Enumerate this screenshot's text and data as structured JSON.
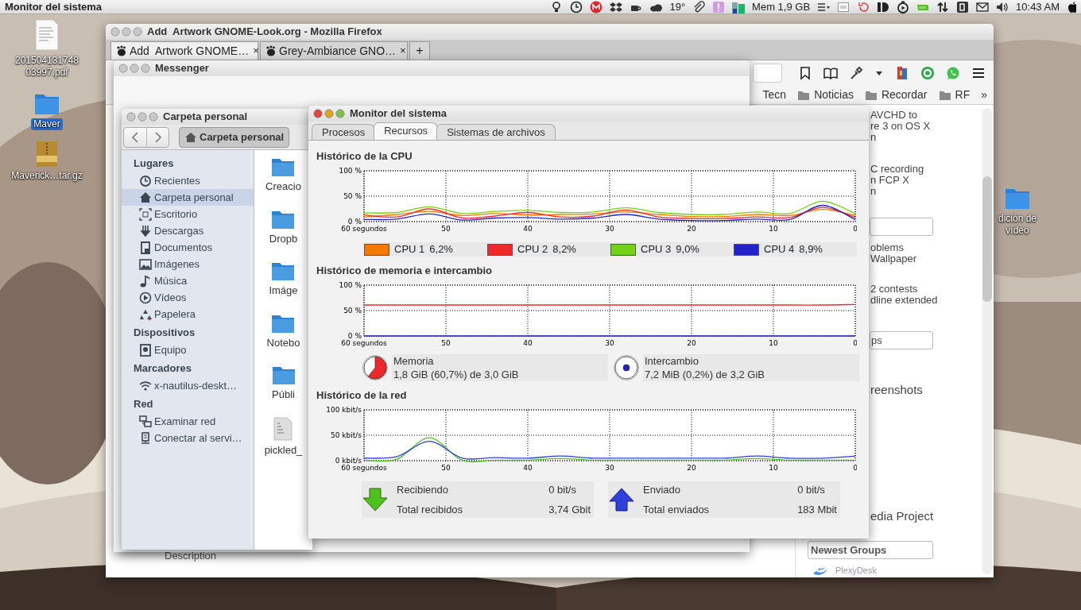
{
  "top_panel": {
    "app_name": "Monitor del sistema",
    "weather": "19°",
    "memory": "Mem 1,9 GB",
    "clock": "10:43 AM"
  },
  "desktop_icons": [
    {
      "label": "201504131748 03997.pdf",
      "kind": "pdf",
      "selected": false
    },
    {
      "label": "Maver",
      "kind": "folder",
      "selected": true
    },
    {
      "label": "Maverick…tar.gz",
      "kind": "archive",
      "selected": false
    },
    {
      "label": "dición de vídeo",
      "kind": "folder",
      "selected": false
    }
  ],
  "firefox": {
    "title": "Add  Artwork GNOME-Look.org - Mozilla Firefox",
    "focused": false,
    "tabs": [
      {
        "label": "Add  Artwork GNOME…",
        "close": "×",
        "selected": true
      },
      {
        "label": "Grey-Ambiance GNO…",
        "close": "×",
        "selected": false
      }
    ],
    "new_tab": "+",
    "bookmarks": [
      "Tecn",
      "Noticias",
      "Recordar",
      "RF"
    ],
    "bookmarks_more": "»",
    "page": {
      "column": [
        {
          "kind": "text",
          "lines": [
            "AVCHD to",
            "re 3 on OS X",
            "n"
          ]
        },
        {
          "kind": "text",
          "lines": [
            "C recording",
            "n FCP X",
            "n"
          ]
        },
        {
          "kind": "field"
        },
        {
          "kind": "text",
          "lines": [
            "oblems",
            "Wallpaper"
          ]
        },
        {
          "kind": "text",
          "lines": [
            "2 contests",
            "dline extended"
          ]
        },
        {
          "kind": "field",
          "value": "ps"
        },
        {
          "kind": "heading",
          "text": "reenshots"
        },
        {
          "kind": "heading",
          "text": "edia Project"
        },
        {
          "kind": "field",
          "value": "Newest Groups"
        },
        {
          "kind": "logo",
          "text": "PlexyDesk"
        }
      ],
      "footer": "Description"
    }
  },
  "messenger": {
    "title": "Messenger",
    "focused": false
  },
  "files": {
    "title": "Carpeta personal",
    "focused": false,
    "path_button": "Carpeta personal",
    "sidebar": [
      {
        "title": "Lugares",
        "items": [
          {
            "label": "Recientes",
            "selected": false
          },
          {
            "label": "Carpeta personal",
            "selected": true
          },
          {
            "label": "Escritorio",
            "selected": false
          },
          {
            "label": "Descargas",
            "selected": false
          },
          {
            "label": "Documentos",
            "selected": false
          },
          {
            "label": "Imágenes",
            "selected": false
          },
          {
            "label": "Música",
            "selected": false
          },
          {
            "label": "Vídeos",
            "selected": false
          },
          {
            "label": "Papelera",
            "selected": false
          }
        ]
      },
      {
        "title": "Dispositivos",
        "items": [
          {
            "label": "Equipo",
            "selected": false
          }
        ]
      },
      {
        "title": "Marcadores",
        "items": [
          {
            "label": "x-nautilus-deskt…",
            "selected": false
          }
        ]
      },
      {
        "title": "Red",
        "items": [
          {
            "label": "Examinar red",
            "selected": false
          },
          {
            "label": "Conectar al servi…",
            "selected": false
          }
        ]
      }
    ],
    "items": [
      {
        "label": "Creacio",
        "kind": "folder"
      },
      {
        "label": "Dropb",
        "kind": "folder"
      },
      {
        "label": "Imáge",
        "kind": "folder"
      },
      {
        "label": "Notebo",
        "kind": "folder"
      },
      {
        "label": "Públi",
        "kind": "folder"
      },
      {
        "label": "pickled_",
        "kind": "file"
      }
    ]
  },
  "monitor": {
    "title": "Monitor del sistema",
    "focused": true,
    "tabs": [
      {
        "label": "Procesos",
        "selected": false
      },
      {
        "label": "Recursos",
        "selected": true
      },
      {
        "label": "Sistemas de archivos",
        "selected": false
      }
    ],
    "cpu": {
      "heading": "Histórico de la CPU",
      "chart_data": {
        "type": "line",
        "grid": true,
        "x": [
          60,
          56,
          52,
          48,
          44,
          40,
          36,
          32,
          28,
          24,
          20,
          16,
          12,
          8,
          4,
          0
        ],
        "xlim": [
          60,
          0
        ],
        "ylim": [
          0,
          100
        ],
        "xticks": [
          {
            "value": 60,
            "label": "60 segundos"
          },
          50,
          40,
          30,
          20,
          10,
          0
        ],
        "yticks": [
          {
            "value": 0,
            "label": "0 %"
          },
          {
            "value": 50,
            "label": "50 %"
          },
          {
            "value": 100,
            "label": "100 %"
          }
        ],
        "series": [
          {
            "name": "CPU 1",
            "color": "#f57900",
            "values": [
              9,
              14,
              20,
              12,
              16,
              13,
              14,
              15,
              19,
              14,
              10,
              10,
              14,
              12,
              24,
              12
            ]
          },
          {
            "name": "CPU 2",
            "color": "#ef2929",
            "values": [
              13,
              9,
              25,
              7,
              11,
              18,
              9,
              11,
              23,
              9,
              6,
              6,
              9,
              8,
              28,
              8
            ]
          },
          {
            "name": "CPU 3",
            "color": "#73d216",
            "values": [
              17,
              18,
              29,
              16,
              20,
              22,
              18,
              19,
              27,
              18,
              14,
              14,
              19,
              16,
              40,
              16
            ]
          },
          {
            "name": "CPU 4",
            "color": "#2222cc",
            "values": [
              4,
              5,
              15,
              3,
              7,
              8,
              5,
              7,
              14,
              5,
              2,
              2,
              5,
              4,
              32,
              4
            ]
          }
        ]
      },
      "legend": [
        {
          "reading": "6,2%"
        },
        {
          "reading": "8,2%"
        },
        {
          "reading": "9,0%"
        },
        {
          "reading": "8,9%"
        }
      ]
    },
    "memory": {
      "heading": "Histórico de memoria e intercambio",
      "chart_data": {
        "type": "line",
        "grid": true,
        "x": [
          60,
          56,
          52,
          48,
          44,
          40,
          36,
          32,
          28,
          24,
          20,
          16,
          12,
          8,
          4,
          0
        ],
        "xlim": [
          60,
          0
        ],
        "ylim": [
          0,
          100
        ],
        "xticks": [
          {
            "value": 60,
            "label": "60 segundos"
          },
          50,
          40,
          30,
          20,
          10,
          0
        ],
        "yticks": [
          {
            "value": 0,
            "label": "0 %"
          },
          {
            "value": 50,
            "label": "50 %"
          },
          {
            "value": 100,
            "label": "100 %"
          }
        ],
        "series": [
          {
            "name": "Memoria",
            "color": "#ef2929",
            "values": [
              61,
              61,
              61,
              61,
              61,
              61,
              61,
              61,
              61,
              61,
              61,
              61,
              61,
              61,
              61,
              62
            ]
          },
          {
            "name": "Intercambio",
            "color": "#2222cc",
            "values": [
              0,
              0,
              0,
              0,
              0,
              0,
              0,
              0,
              0,
              0,
              0,
              0,
              0,
              0,
              0,
              0
            ]
          }
        ]
      },
      "legend": [
        {
          "detail": "1,8 GiB (60,7%) de 3,0 GiB",
          "level": 0.607
        },
        {
          "detail": "7,2 MiB (0,2%) de 3,2 GiB"
        }
      ]
    },
    "network": {
      "heading": "Histórico de la red",
      "chart_data": {
        "type": "line",
        "grid": true,
        "x": [
          60,
          56,
          52,
          48,
          44,
          40,
          36,
          32,
          28,
          24,
          20,
          16,
          12,
          8,
          4,
          0
        ],
        "xlim": [
          60,
          0
        ],
        "ylim": [
          0,
          100
        ],
        "xticks": [
          {
            "value": 60,
            "label": "60 segundos"
          },
          50,
          40,
          30,
          20,
          10,
          0
        ],
        "yticks": [
          {
            "value": 0,
            "label": "0 kbit/s"
          },
          {
            "value": 50,
            "label": "50 kbit/s"
          },
          {
            "value": 100,
            "label": "100 kbit/s"
          }
        ],
        "series": [
          {
            "name": "Recibiendo",
            "color": "#4ec11d",
            "values": [
              1,
              3,
              45,
              1,
              1,
              1,
              4,
              1,
              1,
              1,
              1,
              1,
              4,
              1,
              1,
              1
            ]
          },
          {
            "name": "Enviado",
            "color": "#2f3fdc",
            "values": [
              5,
              8,
              38,
              5,
              6,
              5,
              9,
              5,
              5,
              5,
              5,
              5,
              9,
              5,
              5,
              9
            ]
          }
        ]
      },
      "legend": [
        {
          "rate": "0 bit/s",
          "total_label": "Total recibidos",
          "total": "3,74 Gbit"
        },
        {
          "rate": "0 bit/s",
          "total_label": "Total enviados",
          "total": "183 Mbit"
        }
      ]
    }
  }
}
